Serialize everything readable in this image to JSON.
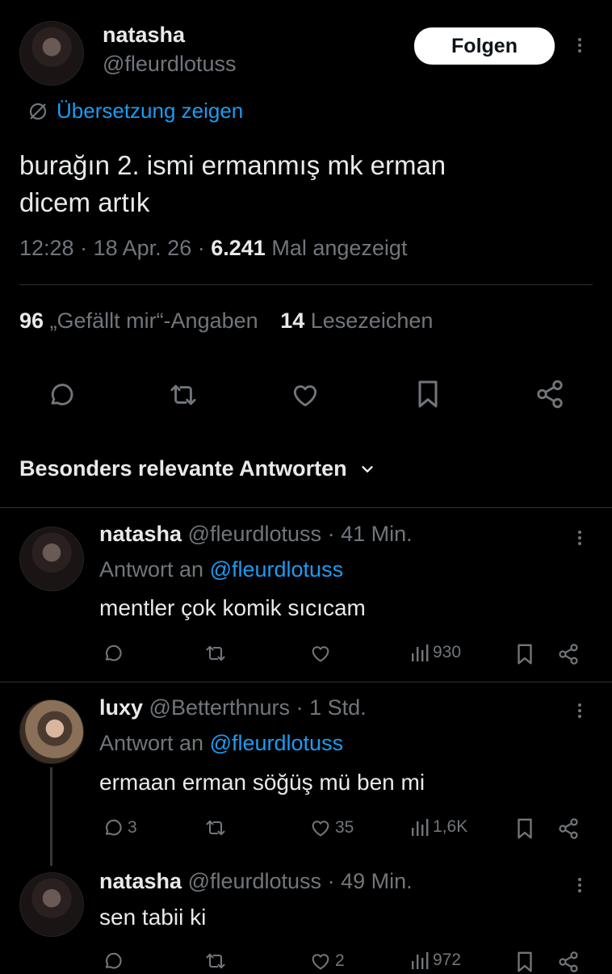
{
  "main_tweet": {
    "author_name": "natasha",
    "author_handle": "@fleurdlotuss",
    "follow_label": "Folgen",
    "translate_label": "Übersetzung zeigen",
    "text_line1": "burağın 2. ismi ermanmış mk erman",
    "text_line2": "dicem artık",
    "time": "12:28",
    "date": "18 Apr. 26",
    "views": "6.241",
    "views_label": "Mal angezeigt",
    "likes": "96",
    "likes_label": "„Gefällt mir“-Angaben",
    "bookmarks": "14",
    "bookmarks_label": "Lesezeichen"
  },
  "replies_header": {
    "label": "Besonders relevante Antworten"
  },
  "replies": [
    {
      "name": "natasha",
      "handle": "@fleurdlotuss",
      "age": "41 Min.",
      "reply_prefix": "Antwort an",
      "reply_to": "@fleurdlotuss",
      "text": "mentler çok komik sıcıcam",
      "comments": "",
      "retweets": "",
      "likes": "",
      "views": "930"
    },
    {
      "name": "luxy",
      "handle": "@Betterthnurs",
      "age": "1 Std.",
      "reply_prefix": "Antwort an",
      "reply_to": "@fleurdlotuss",
      "text": "ermaan erman söğüş mü ben mi",
      "comments": "3",
      "retweets": "",
      "likes": "35",
      "views": "1,6K"
    },
    {
      "name": "natasha",
      "handle": "@fleurdlotuss",
      "age": "49 Min.",
      "text": "sen tabii ki",
      "comments": "",
      "retweets": "",
      "likes": "2",
      "views": "972"
    }
  ],
  "separator": "·",
  "colors": {
    "background": "#000000",
    "text": "#e7e9ea",
    "dim": "#71767b",
    "link": "#1d9bf0",
    "divider": "#2f3336"
  }
}
